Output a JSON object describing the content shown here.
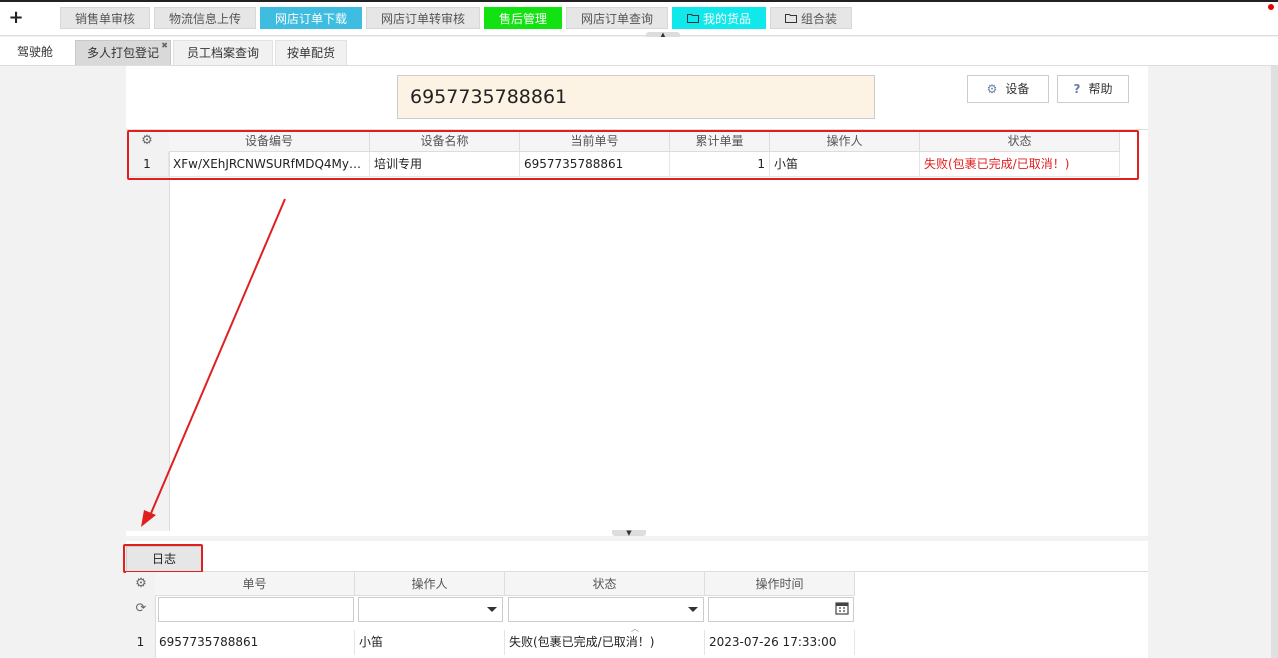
{
  "toolbar": {
    "add_icon": "+",
    "buttons": [
      {
        "label": "销售单审核",
        "bg": "#e6e6e6"
      },
      {
        "label": "物流信息上传",
        "bg": "#e6e6e6"
      },
      {
        "label": "网店订单下载",
        "bg": "#3ebde0"
      },
      {
        "label": "网店订单转审核",
        "bg": "#e6e6e6"
      },
      {
        "label": "售后管理",
        "bg": "#12e212"
      },
      {
        "label": "网店订单查询",
        "bg": "#e6e6e6"
      },
      {
        "label": "我的货品",
        "bg": "#10e8ec",
        "icon": "folder-icon"
      },
      {
        "label": "组合装",
        "bg": "#e6e6e6",
        "icon": "folder-icon"
      }
    ]
  },
  "tabs": [
    {
      "label": "驾驶舱",
      "active": false
    },
    {
      "label": "多人打包登记",
      "active": true
    },
    {
      "label": "员工档案查询",
      "active": false
    },
    {
      "label": "按单配货",
      "active": false
    }
  ],
  "scan_input": {
    "value": "6957735788861"
  },
  "actions": {
    "settings_label": "设备",
    "help_label": "帮助",
    "settings_icon": "gear-icon",
    "help_icon": "question-icon"
  },
  "device_table": {
    "columns": [
      "设备编号",
      "设备名称",
      "当前单号",
      "累计单量",
      "操作人",
      "状态"
    ],
    "rows": [
      {
        "index": "1",
        "device_id": "XFw/XEhJRCNWSURfMDQ4My…",
        "device_name": "培训专用",
        "order_no": "6957735788861",
        "count": "1",
        "operator": "小笛",
        "status": "失败(包裹已完成/已取消！)"
      }
    ]
  },
  "log": {
    "tab_label": "日志",
    "columns": [
      "单号",
      "操作人",
      "状态",
      "操作时间"
    ],
    "rows": [
      {
        "index": "1",
        "order_no": "6957735788861",
        "operator": "小笛",
        "status": "失败(包裹已完成/已取消！)",
        "time": "2023-07-26 17:33:00"
      }
    ]
  },
  "colors": {
    "status_fail": "#e02020",
    "highlight_box": "#e02020",
    "scan_bg": "#fdf3e4"
  }
}
